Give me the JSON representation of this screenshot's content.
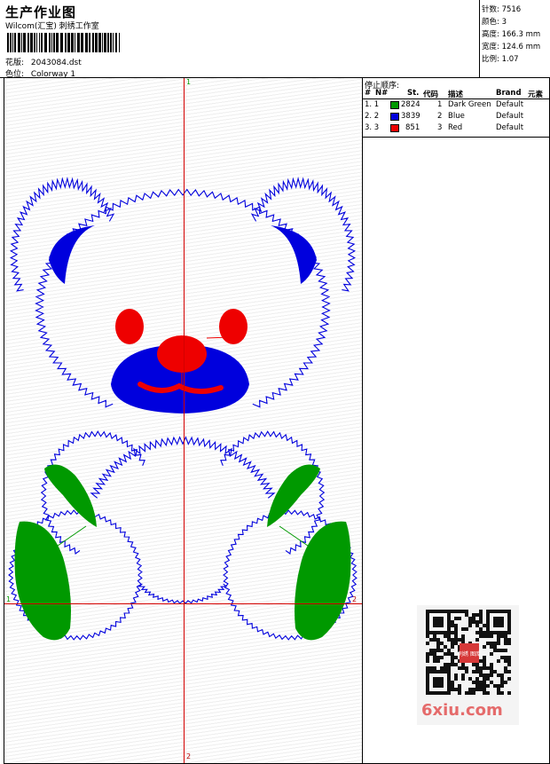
{
  "header": {
    "title": "生产作业图",
    "company": "Wilcom(汇宝) 刺绣工作室",
    "design_label": "花版:",
    "design_value": "2043084.dst",
    "colorway_label": "色位:",
    "colorway_value": "Colorway 1"
  },
  "stats": [
    {
      "label": "针数:",
      "value": "7516"
    },
    {
      "label": "颜色:",
      "value": "3"
    },
    {
      "label": "高度:",
      "value": "166.3 mm"
    },
    {
      "label": "宽度:",
      "value": "124.6 mm"
    },
    {
      "label": "比例:",
      "value": "1.07"
    }
  ],
  "panel": {
    "title": "停止顺序:",
    "columns": [
      "#",
      "N#",
      "St.",
      "代码",
      "描述",
      "Brand",
      "元素"
    ],
    "rows": [
      {
        "idx": "1. 1",
        "color": "#009900",
        "st": "2824",
        "code": "1",
        "desc": "Dark Green",
        "brand": "Default"
      },
      {
        "idx": "2. 2",
        "color": "#0000dd",
        "st": "3839",
        "code": "2",
        "desc": "Blue",
        "brand": "Default"
      },
      {
        "idx": "3. 3",
        "color": "#ee0000",
        "st": "851",
        "code": "3",
        "desc": "Red",
        "brand": "Default"
      }
    ]
  },
  "axes": {
    "v_top": "1",
    "v_bottom": "2",
    "h_left": "1",
    "h_right": "2"
  },
  "colors": {
    "green": "#009900",
    "blue": "#0000dd",
    "red": "#ee0000",
    "axis": "#d40000"
  },
  "watermark": {
    "text": "6xiu.com",
    "stamp": "刺绣 图库"
  }
}
